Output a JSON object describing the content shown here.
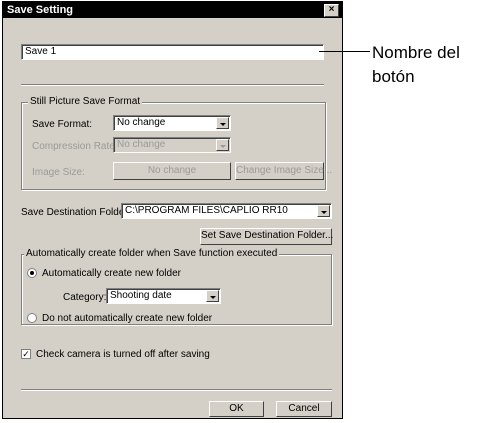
{
  "dialog": {
    "title": "Save Setting",
    "close_symbol": "×",
    "button_name_value": "Save 1",
    "still_picture_group": {
      "title": "Still Picture Save Format",
      "save_format_label": "Save Format:",
      "save_format_value": "No change",
      "compression_rate_label": "Compression Rate:",
      "compression_rate_value": "No change",
      "image_size_label": "Image Size:",
      "image_size_value": "No change",
      "change_image_size_button": "Change Image Size..."
    },
    "save_destination_folder_label": "Save Destination Folder:",
    "save_destination_folder_value": "C:\\PROGRAM FILES\\CAPLIO RR10",
    "set_save_destination_button": "Set Save Destination Folder...",
    "auto_folder_group": {
      "title": "Automatically create folder when Save function executed",
      "auto_create_label": "Automatically create new folder",
      "auto_create_selected": true,
      "category_label": "Category:",
      "category_value": "Shooting date",
      "no_auto_create_label": "Do not automatically create new folder"
    },
    "check_camera_label": "Check camera is turned off after saving",
    "check_camera_checked": true,
    "check_mark": "✓",
    "ok_button": "OK",
    "cancel_button": "Cancel"
  },
  "annotation": {
    "line1": "Nombre del",
    "line2": "botón"
  }
}
